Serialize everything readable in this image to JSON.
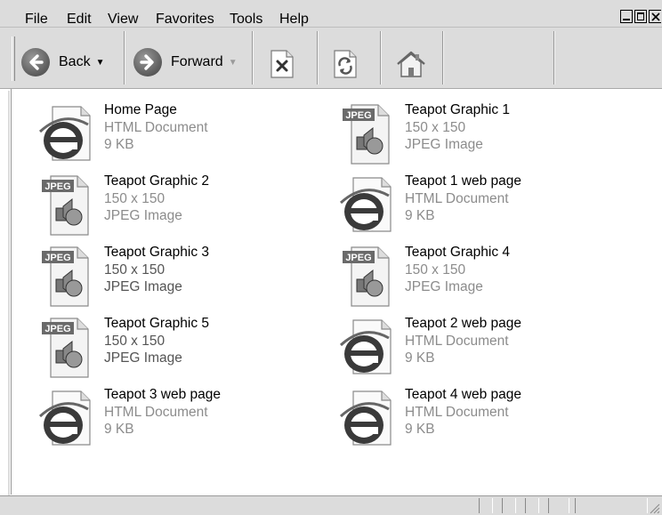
{
  "menubar": {
    "items": [
      "File",
      "Edit",
      "View",
      "Favorites",
      "Tools",
      "Help"
    ]
  },
  "toolbar": {
    "back_label": "Back",
    "forward_label": "Forward"
  },
  "files": [
    {
      "name": "Home Page",
      "line2": "HTML Document",
      "line3": "9 KB",
      "type": "html",
      "dim": true
    },
    {
      "name": "Teapot Graphic 1",
      "line2": "150 x 150",
      "line3": "JPEG Image",
      "type": "jpeg",
      "dim": true
    },
    {
      "name": "Teapot Graphic 2",
      "line2": "150 x 150",
      "line3": "JPEG Image",
      "type": "jpeg",
      "dim": true
    },
    {
      "name": "Teapot 1  web page",
      "line2": "HTML Document",
      "line3": "9 KB",
      "type": "html",
      "dim": true
    },
    {
      "name": "Teapot Graphic 3",
      "line2": "150 x 150",
      "line3": "JPEG Image",
      "type": "jpeg",
      "dim": false
    },
    {
      "name": "Teapot Graphic 4",
      "line2": "150 x 150",
      "line3": "JPEG Image",
      "type": "jpeg",
      "dim": true
    },
    {
      "name": "Teapot Graphic 5",
      "line2": "150 x 150",
      "line3": "JPEG Image",
      "type": "jpeg",
      "dim": false
    },
    {
      "name": "Teapot 2  web page",
      "line2": "HTML Document",
      "line3": "9 KB",
      "type": "html",
      "dim": true
    },
    {
      "name": "Teapot 3  web page",
      "line2": "HTML Document",
      "line3": "9 KB",
      "type": "html",
      "dim": true
    },
    {
      "name": "Teapot 4  web page",
      "line2": "HTML Document",
      "line3": "9 KB",
      "type": "html",
      "dim": true
    }
  ],
  "colors": {
    "chrome": "#dcdcdc",
    "detail_text": "#8c8c8c"
  }
}
